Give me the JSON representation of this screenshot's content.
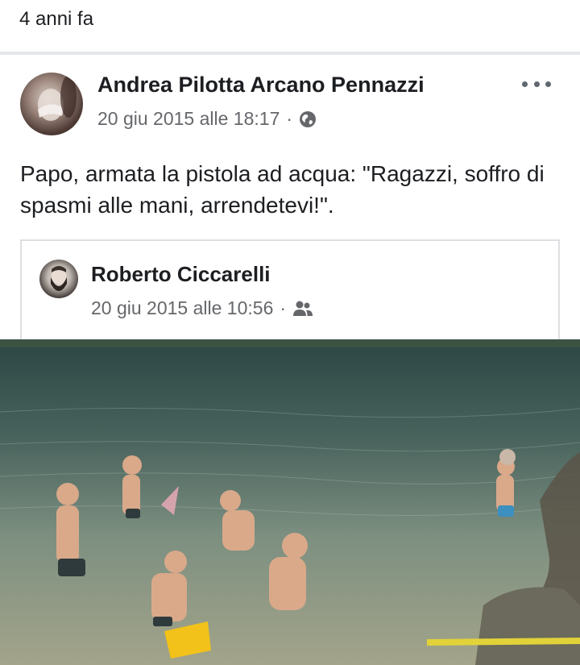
{
  "memory": {
    "label": "4 anni fa"
  },
  "post": {
    "author": "Andrea Pilotta Arcano Pennazzi",
    "date": "20 giu 2015 alle 18:17",
    "separator": "·",
    "privacy_icon": "globe-icon",
    "more_icon": "more-options-icon",
    "text": "Papo, armata la pistola ad acqua: \"Ragazzi, soffro di spasmi alle mani, arrendetevi!\"."
  },
  "shared": {
    "author": "Roberto Ciccarelli",
    "date": "20 giu 2015 alle 10:56",
    "separator": "·",
    "privacy_icon": "friends-icon"
  },
  "colors": {
    "text_primary": "#1c1e21",
    "text_secondary": "#65676b",
    "divider": "#e4e6eb",
    "card_border": "#dddfe2"
  }
}
